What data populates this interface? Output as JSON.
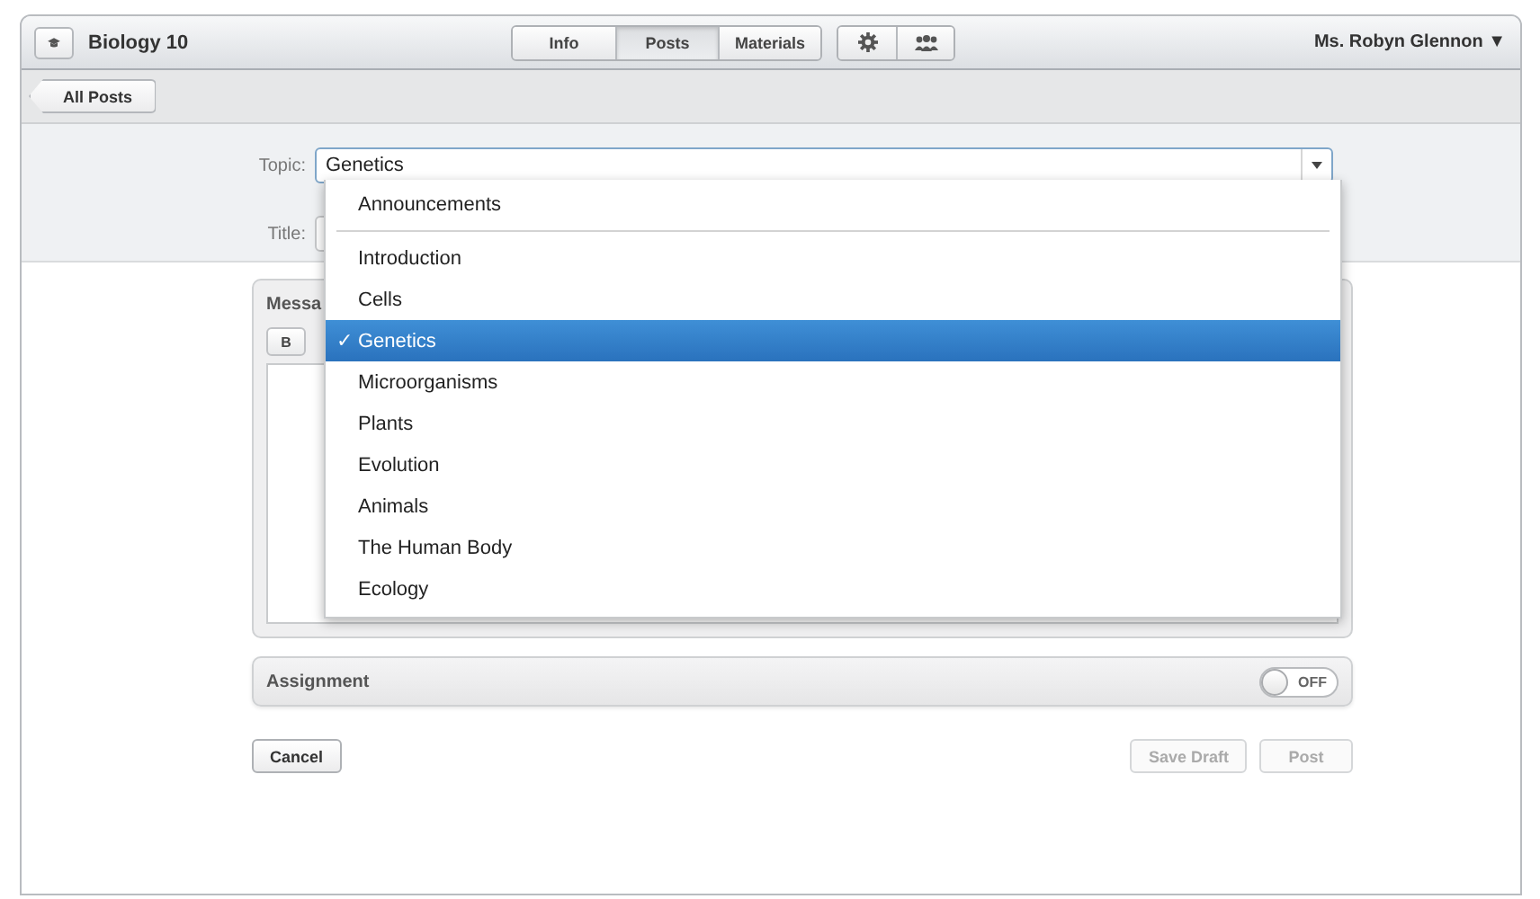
{
  "header": {
    "course": "Biology 10",
    "tabs": [
      {
        "label": "Info",
        "selected": false
      },
      {
        "label": "Posts",
        "selected": true
      },
      {
        "label": "Materials",
        "selected": false
      }
    ],
    "user": "Ms. Robyn Glennon ▼"
  },
  "back_button": "All Posts",
  "form": {
    "topic_label": "Topic:",
    "topic_value": "Genetics",
    "title_label": "Title:"
  },
  "topic_menu": {
    "check_mark": "✓",
    "groups": [
      [
        {
          "label": "Announcements",
          "selected": false
        }
      ],
      [
        {
          "label": "Introduction",
          "selected": false
        },
        {
          "label": "Cells",
          "selected": false
        },
        {
          "label": "Genetics",
          "selected": true
        },
        {
          "label": "Microorganisms",
          "selected": false
        },
        {
          "label": "Plants",
          "selected": false
        },
        {
          "label": "Evolution",
          "selected": false
        },
        {
          "label": "Animals",
          "selected": false
        },
        {
          "label": "The Human Body",
          "selected": false
        },
        {
          "label": "Ecology",
          "selected": false
        }
      ]
    ]
  },
  "message": {
    "heading": "Messa",
    "toolbar": [
      "B"
    ]
  },
  "assignment": {
    "label": "Assignment",
    "toggle": {
      "on": false,
      "label": "OFF"
    }
  },
  "buttons": [
    {
      "label": "Cancel",
      "disabled": false
    },
    {
      "label": "Save Draft",
      "disabled": true
    },
    {
      "label": "Post",
      "disabled": true
    }
  ]
}
